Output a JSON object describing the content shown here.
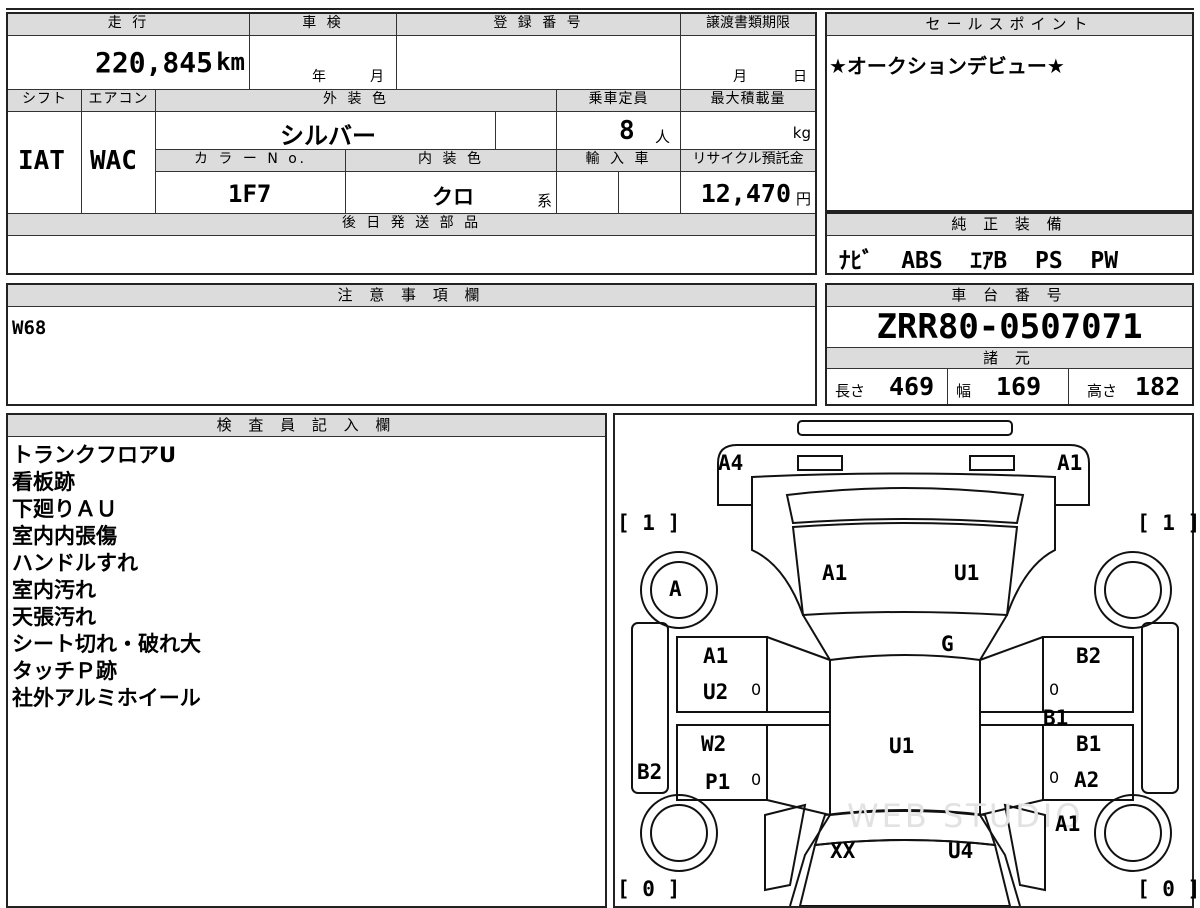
{
  "vehicle": {
    "mileage_label": "走 行",
    "mileage": "220,845",
    "mileage_unit": "km",
    "inspection_label": "車 検",
    "inspection_year": "年",
    "inspection_month": "月",
    "registration_label": "登 録 番 号",
    "transfer_label": "譲渡書類期限",
    "transfer_month": "月",
    "transfer_day": "日",
    "shift_label": "シフト",
    "shift": "IAT",
    "ac_label": "エアコン",
    "ac": "WAC",
    "exterior_color_label": "外 装 色",
    "exterior_color": "シルバー",
    "capacity_label": "乗車定員",
    "capacity": "8",
    "capacity_unit": "人",
    "load_label": "最大積載量",
    "load_unit": "kg",
    "color_no_label": "カ ラ ー N o.",
    "color_no": "1F7",
    "interior_color_label": "内 装 色",
    "interior_color": "クロ",
    "interior_suffix": "系",
    "import_label": "輸 入 車",
    "recycle_label": "リサイクル預託金",
    "recycle_fee": "12,470",
    "recycle_unit": "円",
    "later_parts_label": "後 日 発 送 部 品"
  },
  "sales_point": {
    "label": "セールスポイント",
    "text": "★オークションデビュー★"
  },
  "equipment": {
    "label": "純 正 装 備",
    "text": "ﾅﾋﾞ  ABS  ｴｱB  PS  PW"
  },
  "notes": {
    "label": "注 意 事 項 欄",
    "text": "W68"
  },
  "chassis": {
    "label": "車 台 番 号",
    "number": "ZRR80-0507071",
    "spec_label": "諸 元",
    "length_label": "長さ",
    "length": "469",
    "width_label": "幅",
    "width": "169",
    "height_label": "高さ",
    "height": "182"
  },
  "inspector": {
    "label": "検 査 員 記 入 欄",
    "lines": [
      "トランクフロアU",
      "看板跡",
      "下廻りＡＵ",
      "室内内張傷",
      "ハンドルすれ",
      "室内汚れ",
      "天張汚れ",
      "シート切れ・破れ大",
      "タッチＰ跡",
      "社外アルミホイール"
    ]
  },
  "diagram": {
    "marks": {
      "rear_left": "A4",
      "rear_right": "A1",
      "bracket_tl": "[ 1 ]",
      "bracket_tr": "[ 1 ]",
      "bracket_bl": "[ 0 ]",
      "bracket_br": "[ 0 ]",
      "wheel_fl": "A",
      "glass_left": "A1",
      "glass_right": "U1",
      "glass_center": "G",
      "left_door_a": "A1",
      "left_door_b": "U2",
      "left_door_c": "W2",
      "left_door_d": "P1",
      "left_side": "B2",
      "right_door_a": "B2",
      "right_sill": "B1",
      "right_door_b": "B1",
      "right_door_c": "A2",
      "right_fender": "A1",
      "roof": "U1",
      "hood_left": "XX",
      "hood_right": "U4",
      "zero": "0"
    },
    "watermark": "WEB STUDIO"
  }
}
